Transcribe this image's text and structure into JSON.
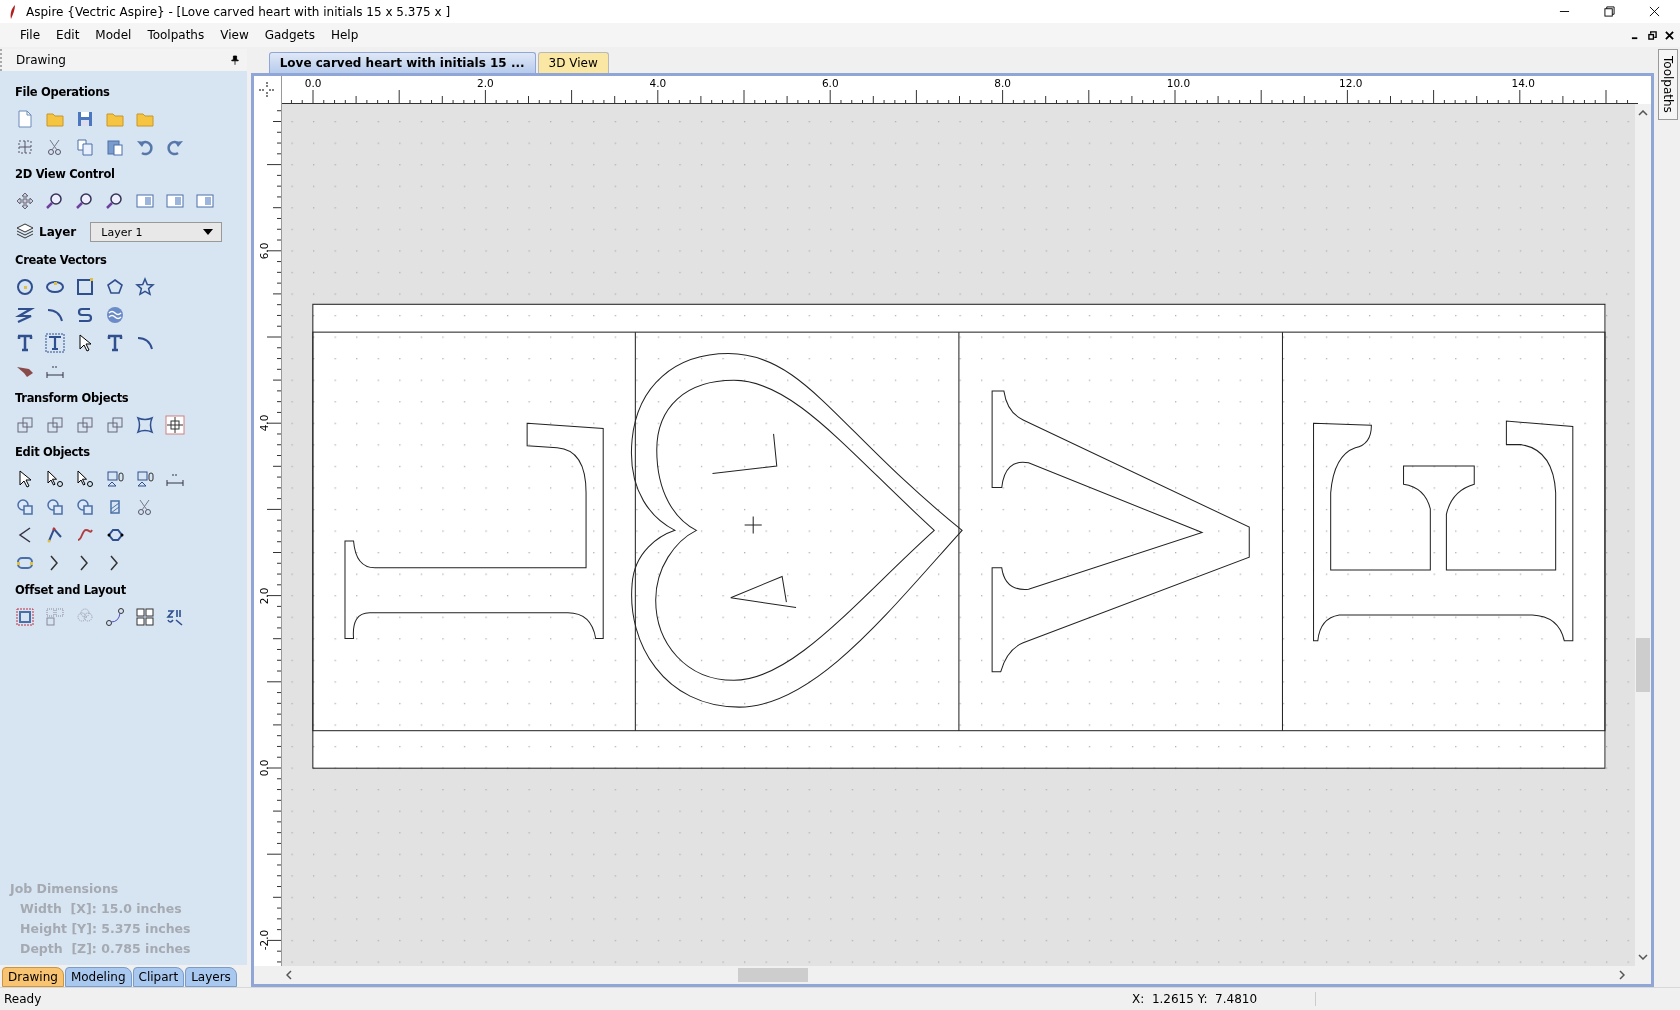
{
  "window": {
    "title": "Aspire {Vectric Aspire} - [Love carved heart with initials 15 x 5.375 x ]"
  },
  "menu": [
    {
      "label": "File"
    },
    {
      "label": "Edit"
    },
    {
      "label": "Model"
    },
    {
      "label": "Toolpaths"
    },
    {
      "label": "View"
    },
    {
      "label": "Gadgets"
    },
    {
      "label": "Help"
    }
  ],
  "left_panel": {
    "title": "Drawing",
    "items": [
      {
        "kind": "section",
        "title": "File Operations"
      },
      {
        "kind": "section",
        "title": "2D View Control"
      },
      {
        "kind": "layer",
        "label": "Layer",
        "value": "Layer 1"
      },
      {
        "kind": "section",
        "title": "Create Vectors"
      },
      {
        "kind": "section",
        "title": "Transform Objects"
      },
      {
        "kind": "section",
        "title": "Edit Objects"
      },
      {
        "kind": "section",
        "title": "Offset and Layout"
      }
    ],
    "job_dimensions": {
      "title": "Job Dimensions",
      "lines": [
        "Width  [X]: 15.0 inches",
        "Height [Y]: 5.375 inches",
        "Depth  [Z]: 0.785 inches"
      ]
    },
    "tabs": [
      {
        "label": "Drawing",
        "selected": true
      },
      {
        "label": "Modeling",
        "selected": false
      },
      {
        "label": "Clipart",
        "selected": false
      },
      {
        "label": "Layers",
        "selected": false
      }
    ]
  },
  "document_tabs": [
    {
      "label": "Love carved heart with initials 15 ...",
      "selected": true
    },
    {
      "label": "3D View",
      "selected": false
    }
  ],
  "ruler": {
    "horizontal": [
      "0.0",
      "2.0",
      "4.0",
      "6.0",
      "8.0",
      "10.0",
      "12.0",
      "14.0"
    ],
    "vertical": [
      "6.0",
      "4.0",
      "2.0",
      "0.0",
      "-2.0"
    ]
  },
  "side_tab": {
    "label": "Toolpaths"
  },
  "status_bar": {
    "message": "Ready",
    "coordinates": "X:  1.2615 Y:  7.4810"
  }
}
